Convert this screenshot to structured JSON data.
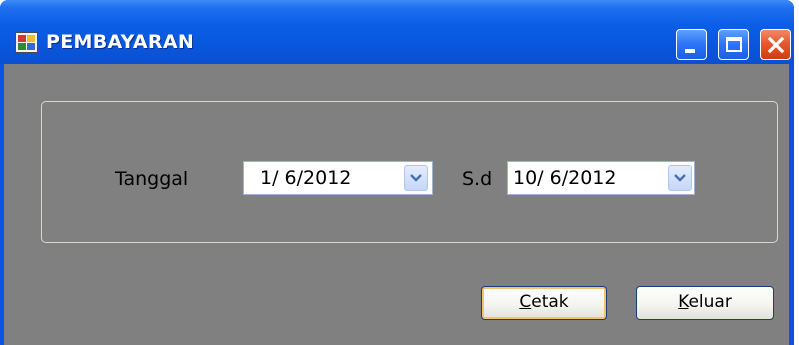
{
  "window": {
    "title": "PEMBAYARAN"
  },
  "form": {
    "tanggal_label": "Tanggal",
    "from_date": "1/  6/2012",
    "sd_label": "S.d",
    "to_date": "10/  6/2012"
  },
  "buttons": {
    "cetak": {
      "accel": "C",
      "rest": "etak"
    },
    "keluar": {
      "accel": "K",
      "rest": "eluar"
    }
  },
  "colors": {
    "titlebar": "#0a55e0",
    "client": "#808080",
    "close_button": "#e55a32"
  },
  "icons": {
    "app": "app-form-icon",
    "minimize": "minimize-icon",
    "maximize": "maximize-icon",
    "close": "close-icon",
    "dropdown": "chevron-down-icon"
  }
}
